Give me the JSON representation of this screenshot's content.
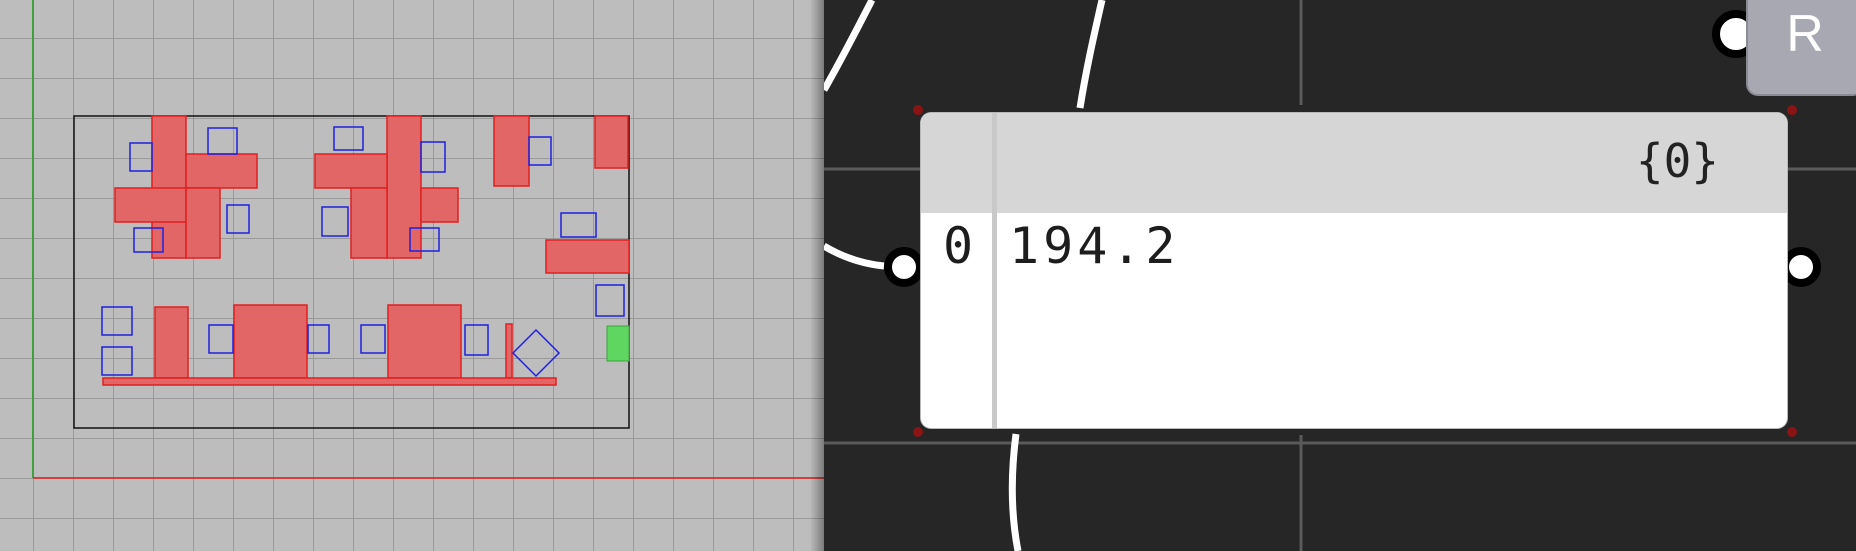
{
  "viewport": {
    "grid_color": "#969696",
    "background_color": "#bdbdbd",
    "x_axis_color": "#d14040",
    "y_axis_color": "#3fa23f",
    "region_fill_color": "#e26666",
    "region_stroke_color": "#e02020",
    "square_color": "#2020e0",
    "green_marker_color": "#5fd65f"
  },
  "panel": {
    "path_label": "{0}",
    "rows": [
      {
        "index": "0",
        "value": "194.2"
      }
    ]
  },
  "canvas": {
    "background_color": "#262626",
    "wire_color": "#ffffff",
    "corner_marker_color": "#8a1414"
  },
  "corner_button": {
    "label": "R"
  }
}
